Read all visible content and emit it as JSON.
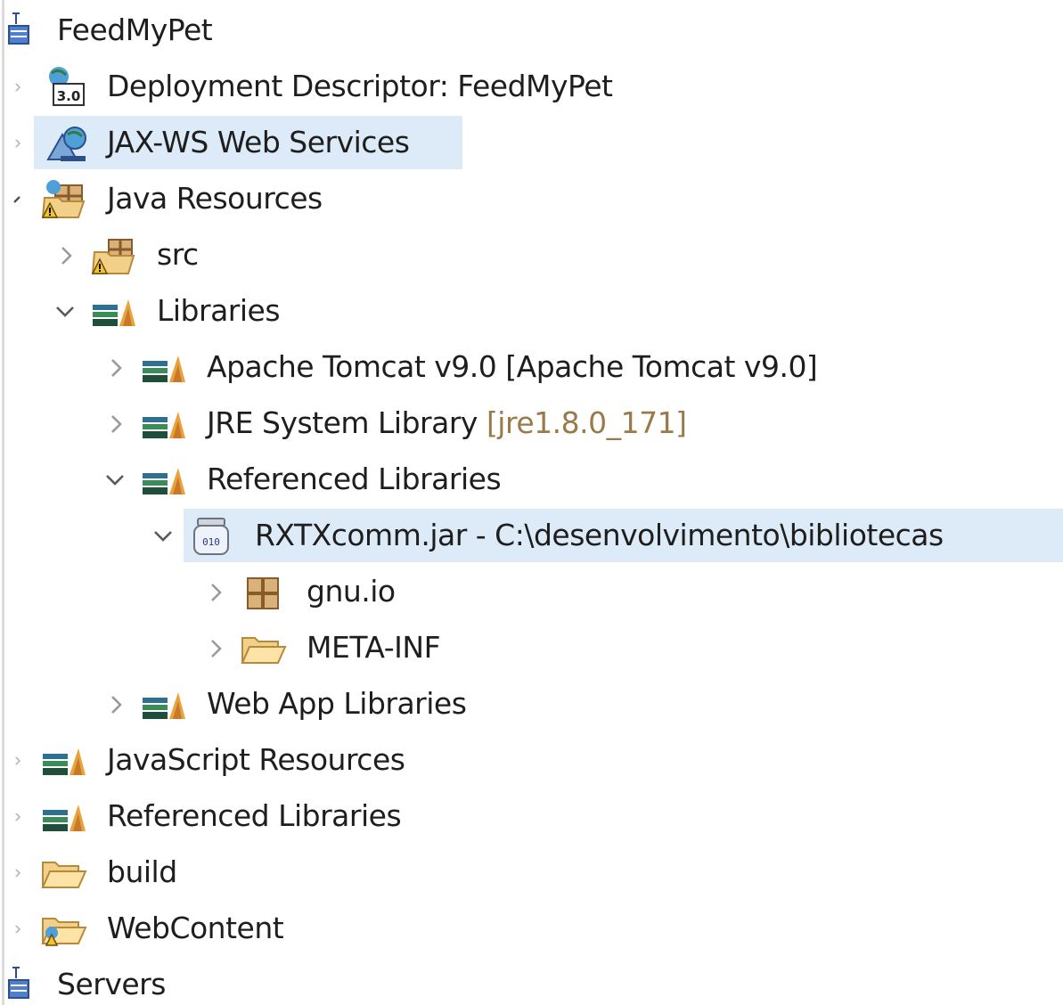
{
  "tree": {
    "project": {
      "label": "FeedMyPet",
      "icon": "web-project-icon"
    },
    "deployment_descriptor": {
      "label": "Deployment Descriptor: FeedMyPet",
      "icon": "deployment-descriptor-icon",
      "expanded": false
    },
    "jaxws": {
      "label": "JAX-WS Web Services",
      "icon": "web-services-icon",
      "expanded": false,
      "selected": true
    },
    "java_resources": {
      "label": "Java Resources",
      "icon": "java-resources-warning-icon",
      "expanded": true
    },
    "src": {
      "label": "src",
      "icon": "source-folder-warning-icon",
      "expanded": false
    },
    "libraries": {
      "label": "Libraries",
      "icon": "library-icon",
      "expanded": true
    },
    "tomcat": {
      "label": "Apache Tomcat v9.0 [Apache Tomcat v9.0]",
      "icon": "library-icon",
      "expanded": false
    },
    "jre": {
      "label": "JRE System Library",
      "decoration": "[jre1.8.0_171]",
      "icon": "library-icon",
      "expanded": false
    },
    "ref_libs_nested": {
      "label": "Referenced Libraries",
      "icon": "library-icon",
      "expanded": true
    },
    "rxtx": {
      "label": "RXTXcomm.jar - C:\\desenvolvimento\\bibliotecas",
      "icon": "jar-icon",
      "expanded": true,
      "selected": true
    },
    "gnu_io": {
      "label": "gnu.io",
      "icon": "package-icon",
      "expanded": false
    },
    "meta_inf": {
      "label": "META-INF",
      "icon": "folder-icon",
      "expanded": false
    },
    "web_app_libs": {
      "label": "Web App Libraries",
      "icon": "library-icon",
      "expanded": false
    },
    "js_resources": {
      "label": "JavaScript Resources",
      "icon": "library-icon",
      "expanded": false
    },
    "ref_libs_top": {
      "label": "Referenced Libraries",
      "icon": "library-icon",
      "expanded": false
    },
    "build": {
      "label": "build",
      "icon": "folder-icon",
      "expanded": false
    },
    "webcontent": {
      "label": "WebContent",
      "icon": "web-folder-icon",
      "expanded": false
    },
    "servers": {
      "label": "Servers",
      "icon": "project-icon"
    }
  },
  "colors": {
    "selection": "#ddeaf7",
    "decoration_text": "#9a7a4a",
    "text": "#1e1e1e",
    "library_green": "#3c8c5a",
    "library_orange": "#e8a33a"
  }
}
